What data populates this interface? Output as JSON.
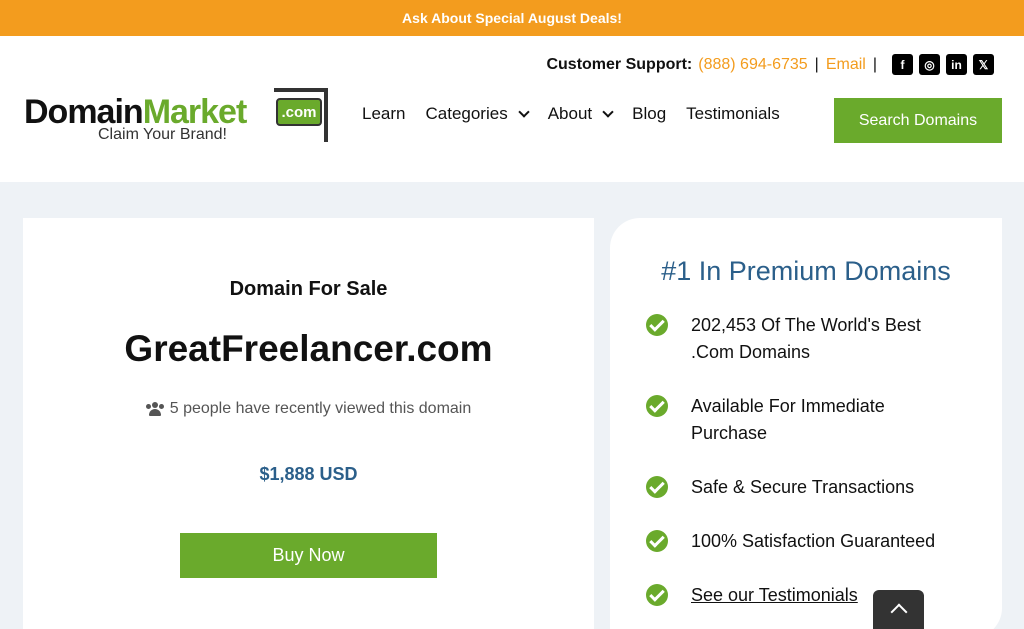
{
  "promo": {
    "text": "Ask About Special August Deals!"
  },
  "header": {
    "support_label": "Customer Support:",
    "phone": "(888) 694-6735",
    "separator": "|",
    "email": "Email",
    "socials": [
      {
        "name": "facebook-icon",
        "glyph": "f"
      },
      {
        "name": "instagram-icon",
        "glyph": "◎"
      },
      {
        "name": "linkedin-icon",
        "glyph": "in"
      },
      {
        "name": "x-icon",
        "glyph": "𝕏"
      }
    ],
    "logo": {
      "domain": "Domain",
      "market": "Market",
      "com": ".com",
      "tagline": "Claim Your Brand!"
    },
    "nav": [
      {
        "label": "Learn",
        "dropdown": false
      },
      {
        "label": "Categories",
        "dropdown": true
      },
      {
        "label": "About",
        "dropdown": true
      },
      {
        "label": "Blog",
        "dropdown": false
      },
      {
        "label": "Testimonials",
        "dropdown": false
      }
    ],
    "search_button": "Search Domains"
  },
  "sale": {
    "heading": "Domain For Sale",
    "domain": "GreatFreelancer.com",
    "viewed_text": "5 people have recently viewed this domain",
    "price": "$1,888 USD",
    "buy_button": "Buy Now"
  },
  "premium": {
    "title": "#1 In Premium Domains",
    "features": [
      {
        "text": "202,453 Of The World's Best .Com Domains",
        "link": false
      },
      {
        "text": "Available For Immediate Purchase",
        "link": false
      },
      {
        "text": "Safe & Secure Transactions",
        "link": false
      },
      {
        "text": "100% Satisfaction Guaranteed",
        "link": false
      },
      {
        "text": "See our Testimonials",
        "link": true
      }
    ]
  },
  "colors": {
    "accent_orange": "#f39c1e",
    "accent_green": "#6aaa2c",
    "accent_blue": "#2b5f8a"
  }
}
